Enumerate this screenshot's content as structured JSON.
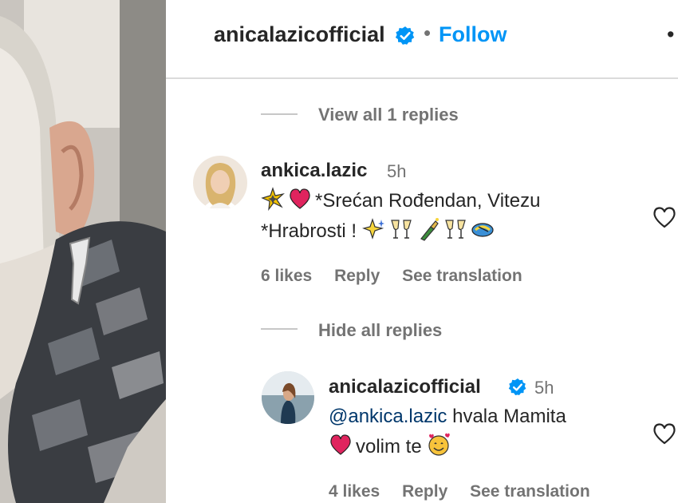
{
  "header": {
    "username": "anicalazicofficial",
    "separator": "•",
    "follow_label": "Follow",
    "more": "•"
  },
  "thread": {
    "view_replies_label": "View all 1 replies",
    "hide_replies_label": "Hide all replies"
  },
  "comments": [
    {
      "username": "ankica.lazic",
      "time": "5h",
      "line1": "*Srećan Rođendan, Vitezu",
      "line2": "*Hrabrosti !",
      "likes": "6 likes",
      "reply": "Reply",
      "translate": "See translation"
    },
    {
      "username": "anicalazicofficial",
      "time": "5h",
      "mention": "@ankica.lazic",
      "line1": "hvala Mamita",
      "line2": "volim te",
      "likes": "4 likes",
      "reply": "Reply",
      "translate": "See translation"
    }
  ],
  "colors": {
    "accent": "#0095f6",
    "verified": "#0095f6",
    "mention": "#00376b",
    "muted": "#737373",
    "heart_emoji": "#e0245e"
  },
  "icons": [
    "verified-badge-icon",
    "heart-outline-icon",
    "sparkle-emoji",
    "red-heart-emoji",
    "champagne-glasses-emoji",
    "champagne-bottle-emoji",
    "smiling-hearts-emoji"
  ]
}
